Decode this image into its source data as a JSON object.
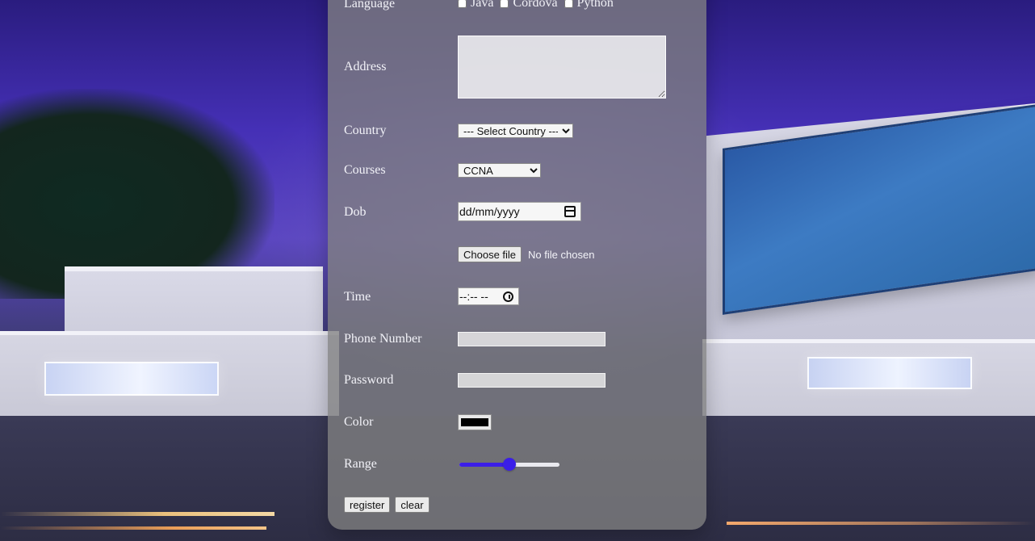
{
  "form": {
    "language": {
      "label": "Language",
      "options": [
        "Java",
        "Cordova",
        "Python"
      ]
    },
    "address": {
      "label": "Address",
      "value": ""
    },
    "country": {
      "label": "Country",
      "selected": "--- Select Country ---"
    },
    "courses": {
      "label": "Courses",
      "selected": "CCNA"
    },
    "dob": {
      "label": "Dob",
      "placeholder": "dd/mm/yyyy"
    },
    "file": {
      "button_label": "Choose file",
      "status": "No file chosen"
    },
    "time": {
      "label": "Time",
      "placeholder": "--:-- --"
    },
    "phone": {
      "label": "Phone Number",
      "value": ""
    },
    "password": {
      "label": "Password",
      "value": ""
    },
    "color": {
      "label": "Color",
      "value": "#000000"
    },
    "range": {
      "label": "Range",
      "value": 0.5,
      "accent": "#3b1ee8"
    },
    "buttons": {
      "register": "register",
      "clear": "clear"
    }
  }
}
